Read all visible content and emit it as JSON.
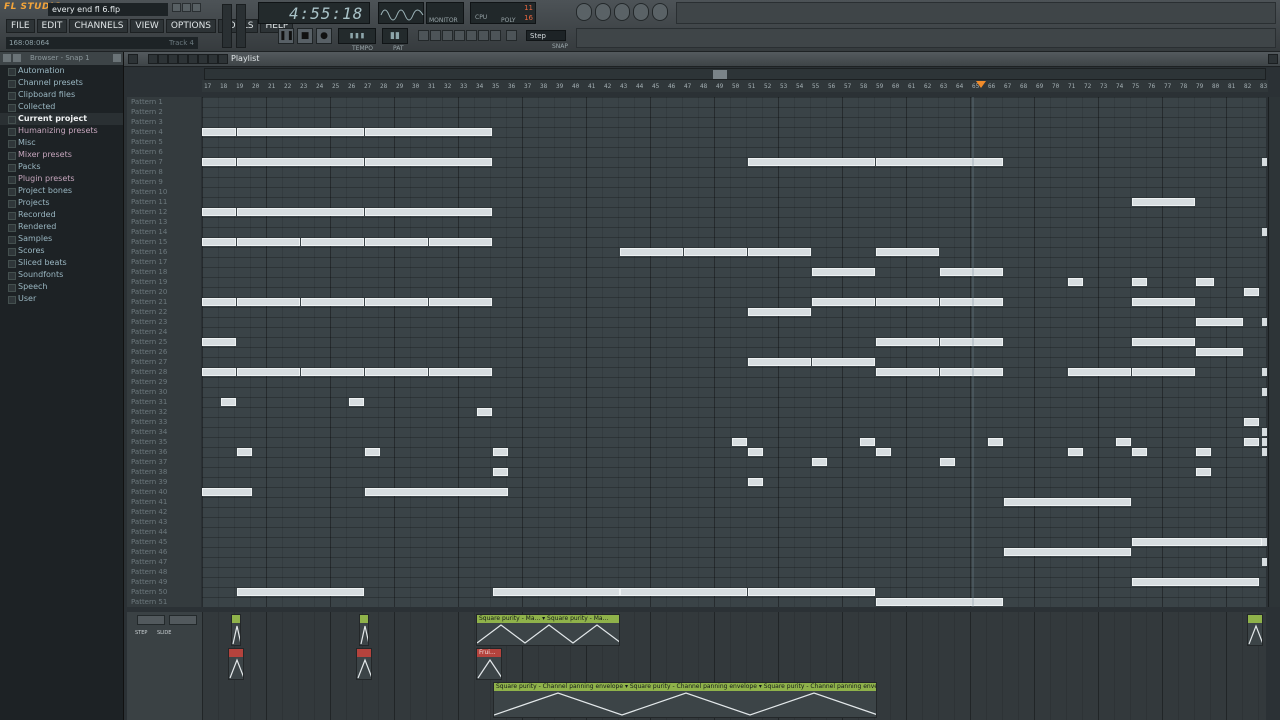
{
  "app": {
    "logo": "FL STUDIO",
    "song_title": "every end fl 6.flp"
  },
  "menu": [
    "FILE",
    "EDIT",
    "CHANNELS",
    "VIEW",
    "OPTIONS",
    "TOOLS",
    "HELP"
  ],
  "hint_bar": {
    "position": "168:08:064",
    "track": "Track 4"
  },
  "transport": {
    "time": "4:55:18",
    "tempo_label": "TEMPO",
    "pat_label": "PAT",
    "monitor_label": "MONITOR",
    "cpu_label": "CPU",
    "poly_label": "POLY",
    "cpu_value": "11",
    "poly_value": "16",
    "snap_label": "SNAP",
    "snap_value": "Step"
  },
  "browser": {
    "title": "Browser - Snap 1",
    "items": [
      {
        "label": "Automation",
        "style": "normal"
      },
      {
        "label": "Channel presets",
        "style": "normal"
      },
      {
        "label": "Clipboard files",
        "style": "normal"
      },
      {
        "label": "Collected",
        "style": "normal"
      },
      {
        "label": "Current project",
        "style": "selected"
      },
      {
        "label": "Humanizing presets",
        "style": "pink"
      },
      {
        "label": "Misc",
        "style": "normal"
      },
      {
        "label": "Mixer presets",
        "style": "pink"
      },
      {
        "label": "Packs",
        "style": "normal"
      },
      {
        "label": "Plugin presets",
        "style": "pink"
      },
      {
        "label": "Project bones",
        "style": "normal"
      },
      {
        "label": "Projects",
        "style": "normal"
      },
      {
        "label": "Recorded",
        "style": "normal"
      },
      {
        "label": "Rendered",
        "style": "normal"
      },
      {
        "label": "Samples",
        "style": "normal"
      },
      {
        "label": "Scores",
        "style": "normal"
      },
      {
        "label": "Sliced beats",
        "style": "normal"
      },
      {
        "label": "Soundfonts",
        "style": "normal"
      },
      {
        "label": "Speech",
        "style": "normal"
      },
      {
        "label": "User",
        "style": "normal"
      }
    ]
  },
  "playlist": {
    "title": "Playlist",
    "patterns": [
      "Pattern 1",
      "Pattern 2",
      "Pattern 3",
      "Pattern 4",
      "Pattern 5",
      "Pattern 6",
      "Pattern 7",
      "Pattern 8",
      "Pattern 9",
      "Pattern 10",
      "Pattern 11",
      "Pattern 12",
      "Pattern 13",
      "Pattern 14",
      "Pattern 15",
      "Pattern 16",
      "Pattern 17",
      "Pattern 18",
      "Pattern 19",
      "Pattern 20",
      "Pattern 21",
      "Pattern 22",
      "Pattern 23",
      "Pattern 24",
      "Pattern 25",
      "Pattern 26",
      "Pattern 27",
      "Pattern 28",
      "Pattern 29",
      "Pattern 30",
      "Pattern 31",
      "Pattern 32",
      "Pattern 33",
      "Pattern 34",
      "Pattern 35",
      "Pattern 36",
      "Pattern 37",
      "Pattern 38",
      "Pattern 39",
      "Pattern 40",
      "Pattern 41",
      "Pattern 42",
      "Pattern 43",
      "Pattern 44",
      "Pattern 45",
      "Pattern 46",
      "Pattern 47",
      "Pattern 48",
      "Pattern 49",
      "Pattern 50",
      "Pattern 51"
    ],
    "ruler": [
      "17",
      "18",
      "19",
      "20",
      "21",
      "22",
      "23",
      "24",
      "25",
      "26",
      "27",
      "28",
      "29",
      "30",
      "31",
      "32",
      "33",
      "34",
      "35",
      "36",
      "37",
      "38",
      "39",
      "40",
      "41",
      "42",
      "43",
      "44",
      "45",
      "46",
      "47",
      "48",
      "49",
      "50",
      "51",
      "52",
      "53",
      "54",
      "55",
      "56",
      "57",
      "58",
      "59",
      "60",
      "61",
      "62",
      "63",
      "64",
      "65",
      "66",
      "67",
      "68",
      "69",
      "70",
      "71",
      "72",
      "73",
      "74",
      "75",
      "76",
      "77",
      "78",
      "79",
      "80",
      "81",
      "82",
      "83"
    ],
    "clips": [
      {
        "row": 3,
        "start": 0,
        "len": 2.2
      },
      {
        "row": 3,
        "start": 2.2,
        "len": 8
      },
      {
        "row": 3,
        "start": 10.2,
        "len": 8
      },
      {
        "row": 6,
        "start": 0,
        "len": 2.2
      },
      {
        "row": 6,
        "start": 2.2,
        "len": 8
      },
      {
        "row": 6,
        "start": 10.2,
        "len": 8
      },
      {
        "row": 6,
        "start": 34.1,
        "len": 8
      },
      {
        "row": 6,
        "start": 42.1,
        "len": 8
      },
      {
        "row": 10,
        "start": 58.1,
        "len": 4
      },
      {
        "row": 11,
        "start": 0,
        "len": 2.2
      },
      {
        "row": 11,
        "start": 2.2,
        "len": 8
      },
      {
        "row": 11,
        "start": 10.2,
        "len": 8
      },
      {
        "row": 14,
        "start": 0,
        "len": 2.2
      },
      {
        "row": 14,
        "start": 2.2,
        "len": 4
      },
      {
        "row": 14,
        "start": 6.2,
        "len": 4
      },
      {
        "row": 14,
        "start": 10.2,
        "len": 4
      },
      {
        "row": 14,
        "start": 14.2,
        "len": 4
      },
      {
        "row": 15,
        "start": 26.1,
        "len": 4
      },
      {
        "row": 15,
        "start": 30.1,
        "len": 4
      },
      {
        "row": 15,
        "start": 34.1,
        "len": 4
      },
      {
        "row": 15,
        "start": 42.1,
        "len": 4
      },
      {
        "row": 17,
        "start": 38.1,
        "len": 4
      },
      {
        "row": 17,
        "start": 46.1,
        "len": 4
      },
      {
        "row": 18,
        "start": 54.1,
        "len": 1
      },
      {
        "row": 18,
        "start": 58.1,
        "len": 1
      },
      {
        "row": 18,
        "start": 62.1,
        "len": 1.2
      },
      {
        "row": 19,
        "start": 65.1,
        "len": 1
      },
      {
        "row": 20,
        "start": 0,
        "len": 2.2
      },
      {
        "row": 20,
        "start": 2.2,
        "len": 4
      },
      {
        "row": 20,
        "start": 6.2,
        "len": 4
      },
      {
        "row": 20,
        "start": 10.2,
        "len": 4
      },
      {
        "row": 20,
        "start": 14.2,
        "len": 4
      },
      {
        "row": 20,
        "start": 38.1,
        "len": 4
      },
      {
        "row": 20,
        "start": 42.1,
        "len": 4
      },
      {
        "row": 20,
        "start": 46.1,
        "len": 4
      },
      {
        "row": 20,
        "start": 58.1,
        "len": 4
      },
      {
        "row": 21,
        "start": 34.1,
        "len": 4
      },
      {
        "row": 22,
        "start": 62.1,
        "len": 3
      },
      {
        "row": 24,
        "start": 0,
        "len": 2.2
      },
      {
        "row": 24,
        "start": 42.1,
        "len": 4
      },
      {
        "row": 24,
        "start": 46.1,
        "len": 4
      },
      {
        "row": 24,
        "start": 58.1,
        "len": 4
      },
      {
        "row": 25,
        "start": 62.1,
        "len": 3
      },
      {
        "row": 26,
        "start": 34.1,
        "len": 4
      },
      {
        "row": 26,
        "start": 38.1,
        "len": 4
      },
      {
        "row": 27,
        "start": 0,
        "len": 2.2
      },
      {
        "row": 27,
        "start": 2.2,
        "len": 4
      },
      {
        "row": 27,
        "start": 6.2,
        "len": 4
      },
      {
        "row": 27,
        "start": 10.2,
        "len": 4
      },
      {
        "row": 27,
        "start": 14.2,
        "len": 4
      },
      {
        "row": 27,
        "start": 42.1,
        "len": 4
      },
      {
        "row": 27,
        "start": 46.1,
        "len": 4
      },
      {
        "row": 27,
        "start": 54.1,
        "len": 4
      },
      {
        "row": 27,
        "start": 58.1,
        "len": 4
      },
      {
        "row": 30,
        "start": 1.2,
        "len": 1
      },
      {
        "row": 30,
        "start": 9.2,
        "len": 1
      },
      {
        "row": 31,
        "start": 17.2,
        "len": 1
      },
      {
        "row": 32,
        "start": 65.1,
        "len": 1
      },
      {
        "row": 34,
        "start": 33.1,
        "len": 1
      },
      {
        "row": 34,
        "start": 41.1,
        "len": 1
      },
      {
        "row": 34,
        "start": 49.1,
        "len": 1
      },
      {
        "row": 34,
        "start": 57.1,
        "len": 1
      },
      {
        "row": 34,
        "start": 65.1,
        "len": 1
      },
      {
        "row": 35,
        "start": 2.2,
        "len": 1
      },
      {
        "row": 35,
        "start": 10.2,
        "len": 1
      },
      {
        "row": 35,
        "start": 18.2,
        "len": 1
      },
      {
        "row": 35,
        "start": 34.1,
        "len": 1
      },
      {
        "row": 35,
        "start": 42.1,
        "len": 1
      },
      {
        "row": 35,
        "start": 54.1,
        "len": 1
      },
      {
        "row": 35,
        "start": 58.1,
        "len": 1
      },
      {
        "row": 35,
        "start": 62.1,
        "len": 1
      },
      {
        "row": 36,
        "start": 38.1,
        "len": 1
      },
      {
        "row": 36,
        "start": 46.1,
        "len": 1
      },
      {
        "row": 37,
        "start": 18.2,
        "len": 1
      },
      {
        "row": 37,
        "start": 62.1,
        "len": 1
      },
      {
        "row": 38,
        "start": 34.1,
        "len": 1
      },
      {
        "row": 39,
        "start": 0,
        "len": 3.2
      },
      {
        "row": 39,
        "start": 10.2,
        "len": 9
      },
      {
        "row": 40,
        "start": 50.1,
        "len": 8
      },
      {
        "row": 44,
        "start": 58.1,
        "len": 8.2
      },
      {
        "row": 45,
        "start": 50.1,
        "len": 8
      },
      {
        "row": 48,
        "start": 58.1,
        "len": 8
      },
      {
        "row": 49,
        "start": 2.2,
        "len": 8
      },
      {
        "row": 49,
        "start": 18.2,
        "len": 8
      },
      {
        "row": 49,
        "start": 26.1,
        "len": 8
      },
      {
        "row": 49,
        "start": 34.1,
        "len": 8
      },
      {
        "row": 50,
        "start": 42.1,
        "len": 8
      }
    ],
    "auto_lanes": {
      "step_label": "STEP",
      "slide_label": "SLIDE",
      "clips": [
        {
          "lane": 0,
          "start": 1.8,
          "len": 0.5,
          "color": "green",
          "label": ""
        },
        {
          "lane": 0,
          "start": 9.8,
          "len": 0.5,
          "color": "green",
          "label": ""
        },
        {
          "lane": 0,
          "start": 17.1,
          "len": 9,
          "color": "green",
          "label": "Square purity - Ma... ▾ Square purity - Ma..."
        },
        {
          "lane": 0,
          "start": 65.3,
          "len": 1,
          "color": "green",
          "label": ""
        },
        {
          "lane": 1,
          "start": 1.6,
          "len": 1,
          "color": "red",
          "label": ""
        },
        {
          "lane": 1,
          "start": 9.6,
          "len": 1,
          "color": "red",
          "label": ""
        },
        {
          "lane": 1,
          "start": 17.1,
          "len": 1.6,
          "color": "red",
          "label": "Frui..."
        },
        {
          "lane": 2,
          "start": 18.2,
          "len": 24,
          "color": "green",
          "label": "Square purity - Channel panning envelope ▾ Square purity - Channel panning envelope ▾ Square purity - Channel panning envelope"
        }
      ]
    }
  },
  "colors": {
    "accent": "#f08b2a",
    "clip": "#d7dde0",
    "background": "#2b3135"
  }
}
